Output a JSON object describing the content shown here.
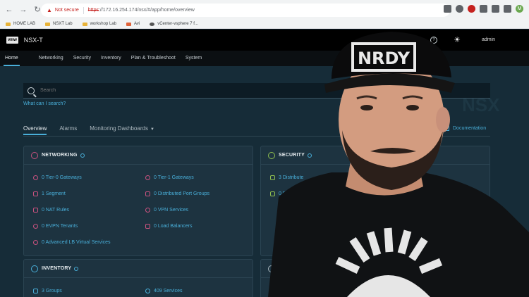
{
  "browser": {
    "security_label": "Not secure",
    "url_https": "https",
    "url_rest": "://172.16.254.174/nsx/#/app/home/overview",
    "avatar_letter": "M",
    "bookmarks": [
      "HOME LAB",
      "NSXT Lab",
      "workshop Lab",
      "Avi",
      "vCenter-vsphere 7 f..."
    ]
  },
  "header": {
    "logo": "vmw",
    "product": "NSX-T",
    "user": "admin"
  },
  "nav": {
    "tabs": [
      "Home",
      "Networking",
      "Security",
      "Inventory",
      "Plan & Troubleshoot",
      "System"
    ]
  },
  "search": {
    "placeholder": "Search",
    "help": "What can I search?"
  },
  "watermark": "NSX",
  "subtabs": {
    "overview": "Overview",
    "alarms": "Alarms",
    "dashboards": "Monitoring Dashboards",
    "documentation": "Documentation"
  },
  "cards": {
    "networking": {
      "title": "NETWORKING",
      "items": [
        "0 Tier-0 Gateways",
        "0 Tier-1 Gateways",
        "1 Segment",
        "0 Distributed Port Groups",
        "0 NAT Rules",
        "0 VPN Services",
        "0 EVPN Tenants",
        "0 Load Balancers",
        "0 Advanced LB Virtual Services"
      ]
    },
    "security": {
      "title": "SECURITY",
      "items": [
        "3 Distribute",
        "0 E"
      ]
    },
    "inventory": {
      "title": "INVENTORY",
      "items": [
        "3 Groups",
        "409 Services"
      ]
    }
  },
  "overlay": {
    "cap_text": "NRDY"
  },
  "colors": {
    "accent": "#49afd9",
    "networking_icon": "#c9527f",
    "security_icon": "#8fbf4f",
    "inventory_icon": "#49afd9"
  }
}
